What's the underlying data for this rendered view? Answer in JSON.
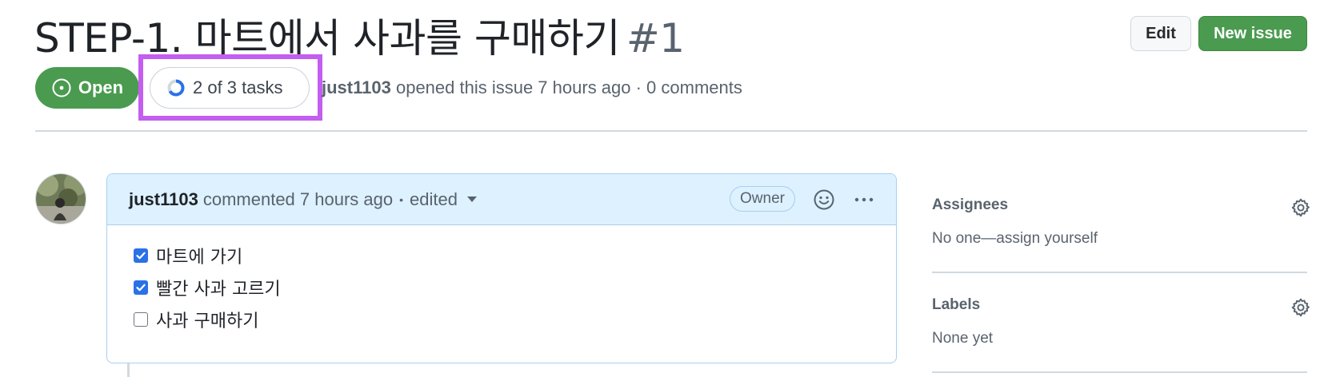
{
  "issue": {
    "title": "STEP-1. 마트에서 사과를 구매하기",
    "number": "#1",
    "state": "Open",
    "tasks_summary": "2 of 3 tasks",
    "tasks_progress": 0.667,
    "author": "just1103",
    "meta": "opened this issue 7 hours ago · 0 comments"
  },
  "header_actions": {
    "edit_label": "Edit",
    "new_issue_label": "New issue"
  },
  "comment": {
    "author": "just1103",
    "timestamp": "commented 7 hours ago",
    "separator": "•",
    "edited": "edited",
    "role_badge": "Owner",
    "tasks": [
      {
        "label": "마트에 가기",
        "checked": true
      },
      {
        "label": "빨간 사과 고르기",
        "checked": true
      },
      {
        "label": "사과 구매하기",
        "checked": false
      }
    ]
  },
  "sidebar": {
    "assignees": {
      "heading": "Assignees",
      "value": "No one—assign yourself"
    },
    "labels": {
      "heading": "Labels",
      "value": "None yet"
    }
  },
  "colors": {
    "open_green": "#4a9b4f",
    "checkbox_blue": "#2a72e6",
    "highlight_purple": "#c35ef0",
    "comment_header_bg": "#ddf1ff"
  }
}
